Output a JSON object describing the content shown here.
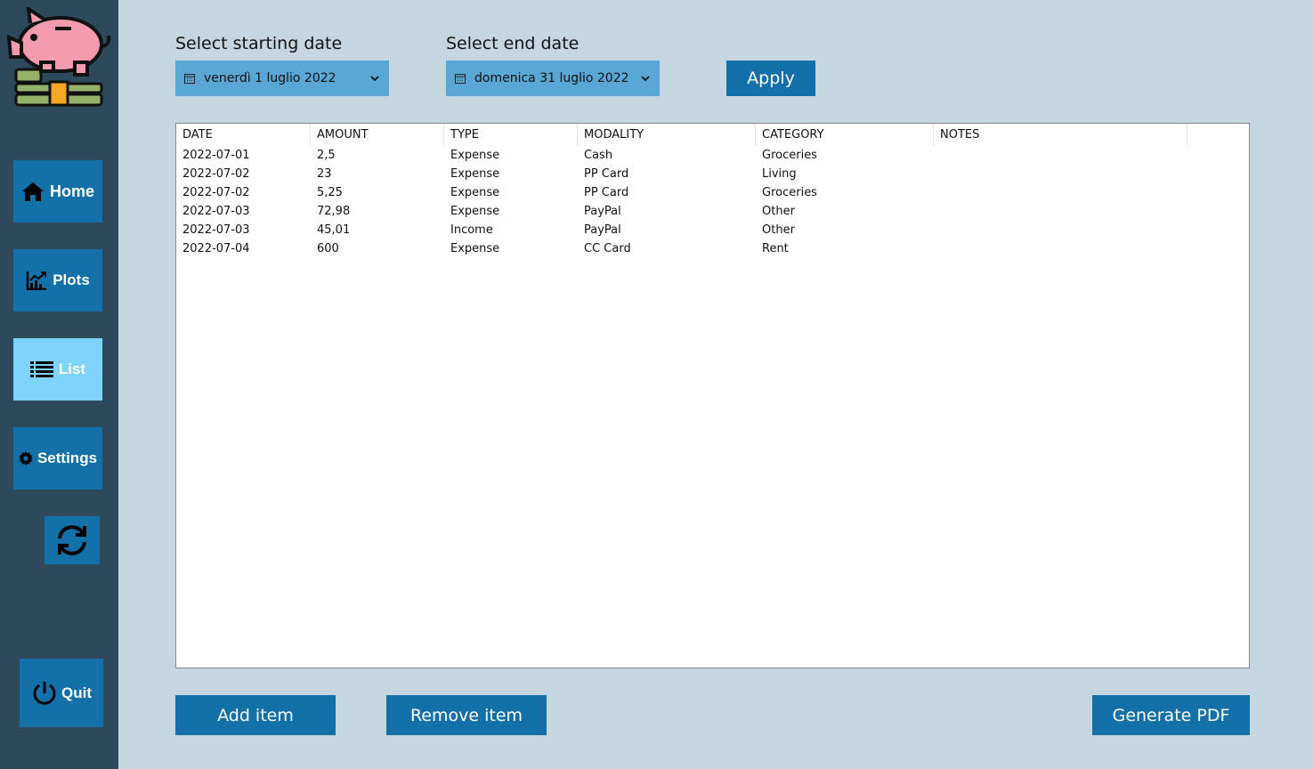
{
  "sidebar": {
    "logo_icon": "piggy-bank-coins-icon",
    "items": [
      {
        "label": "Home",
        "icon": "home-icon",
        "active": false
      },
      {
        "label": "Plots",
        "icon": "chart-icon",
        "active": false
      },
      {
        "label": "List",
        "icon": "list-icon",
        "active": true
      },
      {
        "label": "Settings",
        "icon": "gear-icon",
        "active": false
      }
    ],
    "refresh_icon": "refresh-icon",
    "quit_label": "Quit",
    "quit_icon": "power-icon"
  },
  "filters": {
    "start_label": "Select starting date",
    "start_value": "venerdì 1 luglio 2022",
    "end_label": "Select end date",
    "end_value": "domenica 31 luglio 2022",
    "apply_label": "Apply"
  },
  "table": {
    "columns": [
      "DATE",
      "AMOUNT",
      "TYPE",
      "MODALITY",
      "CATEGORY",
      "NOTES"
    ],
    "rows": [
      [
        "2022-07-01",
        "2,5",
        "Expense",
        "Cash",
        "Groceries",
        ""
      ],
      [
        "2022-07-02",
        "23",
        "Expense",
        "PP Card",
        "Living",
        ""
      ],
      [
        "2022-07-02",
        "5,25",
        "Expense",
        "PP Card",
        "Groceries",
        ""
      ],
      [
        "2022-07-03",
        "72,98",
        "Expense",
        "PayPal",
        "Other",
        ""
      ],
      [
        "2022-07-03",
        "45,01",
        "Income",
        "PayPal",
        "Other",
        ""
      ],
      [
        "2022-07-04",
        "600",
        "Expense",
        "CC Card",
        "Rent",
        ""
      ]
    ]
  },
  "actions": {
    "add_label": "Add item",
    "remove_label": "Remove item",
    "pdf_label": "Generate PDF"
  },
  "colors": {
    "background": "#c4d6e0",
    "sidebar": "#2c4a5c",
    "button": "#1370a8",
    "active_button": "#7ed3fb",
    "date_picker": "#5aa7d6"
  }
}
